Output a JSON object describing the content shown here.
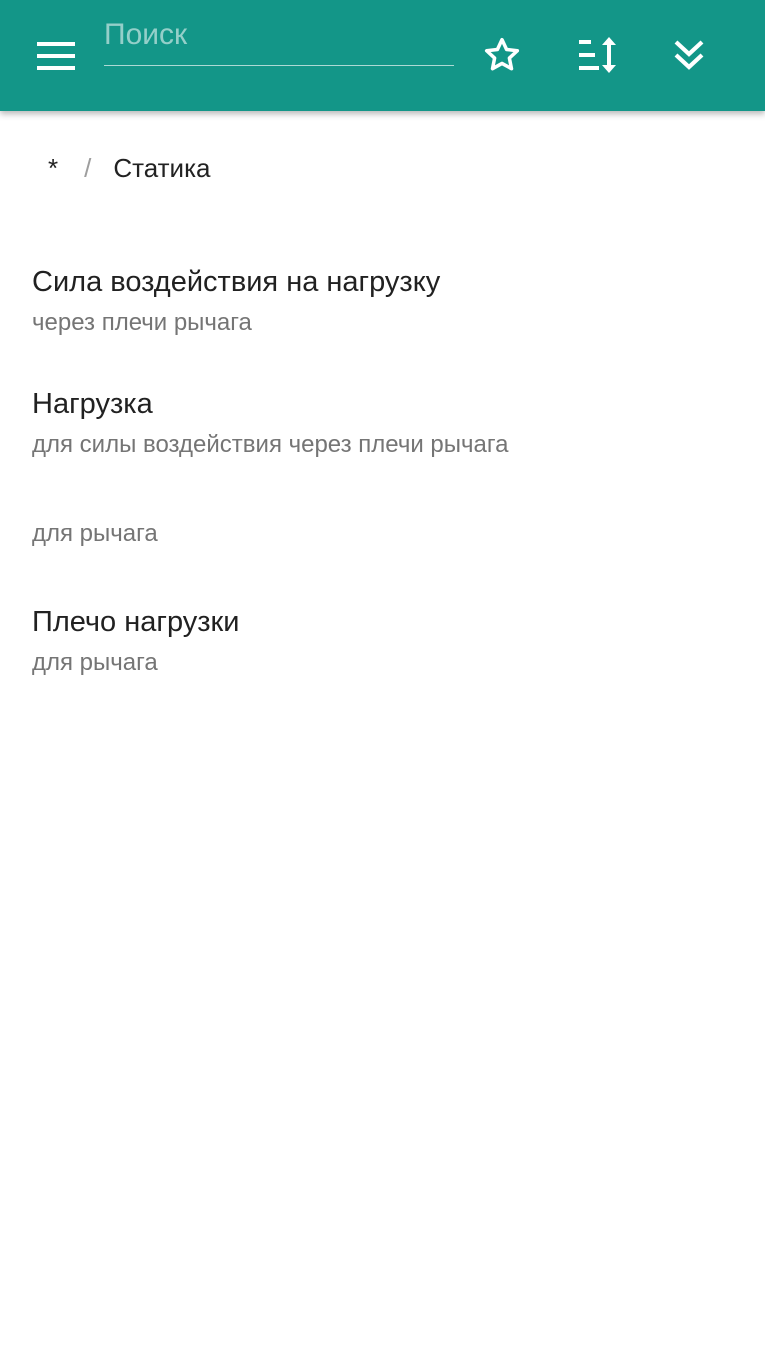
{
  "header": {
    "background_color": "#139688",
    "search": {
      "placeholder": "Поиск",
      "value": ""
    },
    "icons": {
      "menu": "menu-icon",
      "favorite": "star-outline-icon",
      "sort": "sort-icon",
      "expand": "double-chevron-down-icon"
    }
  },
  "breadcrumb": {
    "root": "*",
    "separator": "/",
    "current": "Статика"
  },
  "items": [
    {
      "title": "Сила воздействия на нагрузку",
      "subtitle": "через плечи рычага"
    },
    {
      "title": "Нагрузка",
      "subtitle": "для силы воздействия через плечи рычага"
    },
    {
      "title": "",
      "subtitle": "для рычага"
    },
    {
      "title": "Плечо нагрузки",
      "subtitle": "для рычага"
    }
  ]
}
